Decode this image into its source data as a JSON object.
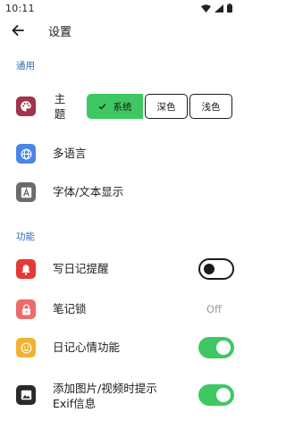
{
  "status": {
    "time": "10:11"
  },
  "app_bar": {
    "title": "设置"
  },
  "sections": {
    "general": {
      "title": "通用"
    },
    "features": {
      "title": "功能"
    }
  },
  "theme": {
    "label": "主\n题",
    "options": [
      "系统",
      "深色",
      "浅色"
    ],
    "selected": "系统",
    "icon": "palette-icon"
  },
  "language": {
    "label": "多语言",
    "icon": "globe-icon"
  },
  "font": {
    "label": "字体/文本显示",
    "icon": "font-icon"
  },
  "reminder": {
    "label": "写日记提醒",
    "enabled": false,
    "icon": "bell-icon"
  },
  "lock": {
    "label": "笔记锁",
    "state_text": "Off",
    "icon": "lock-icon"
  },
  "mood": {
    "label": "日记心情功能",
    "enabled": true,
    "icon": "smiley-icon"
  },
  "exif": {
    "label": "添加图片/视频时提示\nExif信息",
    "enabled": true,
    "icon": "image-icon"
  },
  "colors": {
    "accent_green": "#3fc763",
    "section_blue": "#2f6fb8",
    "palette_icon_bg": "#a3324c",
    "globe_icon_bg": "#4a86e8",
    "font_icon_bg": "#6b6b6b",
    "bell_icon_bg": "#e53935",
    "lock_icon_bg": "#ef6b6b",
    "smiley_icon_bg": "#f2b233",
    "image_icon_bg": "#2a2a2a"
  }
}
